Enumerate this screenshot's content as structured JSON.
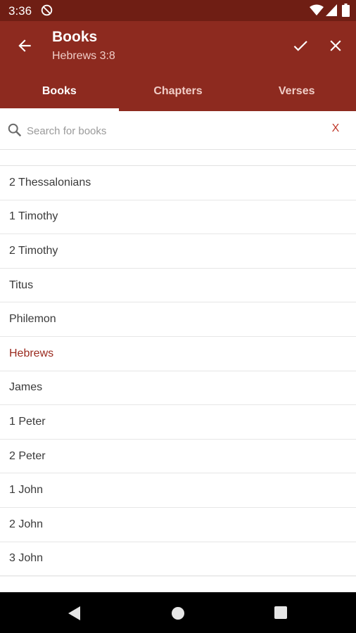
{
  "status_bar": {
    "time": "3:36",
    "icons": [
      "do-not-disturb-icon",
      "wifi-icon",
      "signal-icon",
      "battery-icon"
    ]
  },
  "app_bar": {
    "title": "Books",
    "subtitle": "Hebrews 3:8",
    "color": "#8d2a1f",
    "actions": [
      "back-arrow-icon",
      "check-icon",
      "close-icon"
    ]
  },
  "tabs": [
    {
      "label": "Books",
      "active": true
    },
    {
      "label": "Chapters",
      "active": false
    },
    {
      "label": "Verses",
      "active": false
    }
  ],
  "search": {
    "placeholder": "Search for books",
    "value": "",
    "clear_label": "X"
  },
  "books": [
    {
      "name": "2 Thessalonians"
    },
    {
      "name": "1 Timothy"
    },
    {
      "name": "2 Timothy"
    },
    {
      "name": "Titus"
    },
    {
      "name": "Philemon"
    },
    {
      "name": "Hebrews",
      "selected": true
    },
    {
      "name": "James"
    },
    {
      "name": "1 Peter"
    },
    {
      "name": "2 Peter"
    },
    {
      "name": "1 John"
    },
    {
      "name": "2 John"
    },
    {
      "name": "3 John"
    }
  ],
  "colors": {
    "status_bar": "#6f1e14",
    "accent": "#8d2a1f",
    "selected_text": "#9a2a1e",
    "clear_x": "#c0392b"
  }
}
